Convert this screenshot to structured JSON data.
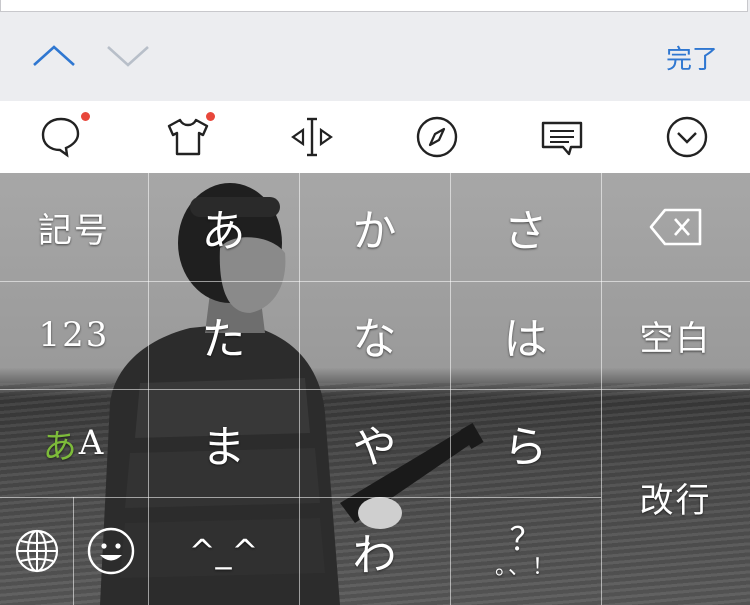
{
  "accessory_bar": {
    "done_label": "完了"
  },
  "toolbar": {
    "icons": [
      "chat-bubble-icon",
      "shirt-icon",
      "cursor-move-icon",
      "compass-icon",
      "message-icon",
      "chevron-down-circle-icon"
    ],
    "badge_color": "#e8473b"
  },
  "keyboard": {
    "symbols_label": "記号",
    "numbers_label": "123",
    "kana_a": "あ",
    "latin_a": "A",
    "kana_a_color": "#7dbb3a",
    "row1": [
      "あ",
      "か",
      "さ"
    ],
    "row2": [
      "た",
      "な",
      "は"
    ],
    "row3": [
      "ま",
      "や",
      "ら"
    ],
    "kaomoji": "^_^",
    "wa": "わ",
    "punct_top": "？",
    "punct_bottom": "。、！",
    "space_label": "空白",
    "return_label": "改行"
  },
  "colors": {
    "accent": "#2f77d1"
  }
}
